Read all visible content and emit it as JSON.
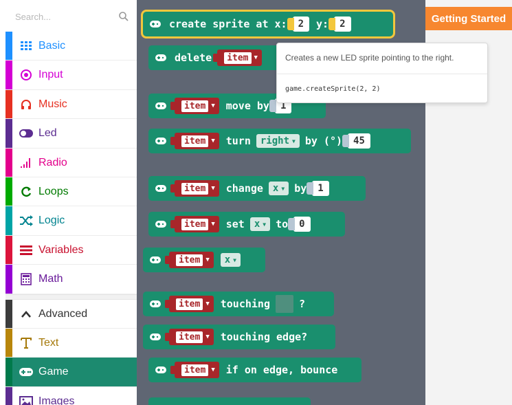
{
  "search": {
    "placeholder": "Search..."
  },
  "categories": [
    {
      "label": "Basic",
      "color": "#1e90ff",
      "icon": "grid-icon"
    },
    {
      "label": "Input",
      "color": "#d400d4",
      "icon": "target-icon"
    },
    {
      "label": "Music",
      "color": "#e63022",
      "icon": "headphones-icon"
    },
    {
      "label": "Led",
      "color": "#5c2d91",
      "icon": "toggle-icon"
    },
    {
      "label": "Radio",
      "color": "#e3008c",
      "icon": "signal-bars-icon"
    },
    {
      "label": "Loops",
      "color": "#00aa00",
      "icon": "loop-arrow-icon"
    },
    {
      "label": "Logic",
      "color": "#00a4a6",
      "icon": "shuffle-icon"
    },
    {
      "label": "Variables",
      "color": "#dc143c",
      "icon": "list-lines-icon"
    },
    {
      "label": "Math",
      "color": "#9400d3",
      "icon": "calculator-icon"
    },
    {
      "label": "Advanced",
      "color": "#3c3c3c",
      "icon": "chevron-up-icon"
    },
    {
      "label": "Text",
      "color": "#b8860b",
      "icon": "text-t-icon"
    },
    {
      "label": "Game",
      "color": "#007a4b",
      "icon": "gamepad-icon"
    },
    {
      "label": "Images",
      "color": "#5c2d91",
      "icon": "image-icon"
    }
  ],
  "workspace": {
    "getting_started": "Getting Started"
  },
  "blocks": {
    "create": {
      "label": "create sprite at x:",
      "x": "2",
      "ylabel": "y:",
      "y": "2"
    },
    "delete": {
      "label": "delete",
      "var": "item"
    },
    "move": {
      "var": "item",
      "label": "move by",
      "value": "1"
    },
    "turn": {
      "var": "item",
      "label": "turn",
      "dir": "right",
      "by": "by (°)",
      "value": "45"
    },
    "change": {
      "var": "item",
      "label": "change",
      "prop": "x",
      "by": "by",
      "value": "1"
    },
    "set": {
      "var": "item",
      "label": "set",
      "prop": "x",
      "to": "to",
      "value": "0"
    },
    "get": {
      "var": "item",
      "prop": "x"
    },
    "touching": {
      "var": "item",
      "label": "touching",
      "q": "?"
    },
    "touching_edge": {
      "var": "item",
      "label": "touching edge?"
    },
    "bounce": {
      "var": "item",
      "label": "if on edge, bounce"
    }
  },
  "tooltip": {
    "text": "Creates a new LED sprite pointing to the right.",
    "code": "game.createSprite(2, 2)"
  }
}
